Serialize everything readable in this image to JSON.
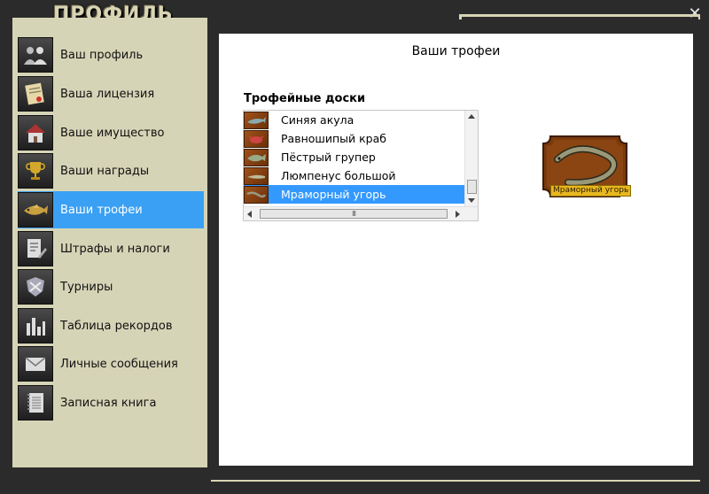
{
  "window": {
    "title": "ПРОФИЛЬ",
    "close_label": "✕"
  },
  "sidebar": {
    "items": [
      {
        "label": "Ваш профиль",
        "icon": "users-icon",
        "active": false
      },
      {
        "label": "Ваша лицензия",
        "icon": "license-icon",
        "active": false
      },
      {
        "label": "Ваше имущество",
        "icon": "house-icon",
        "active": false
      },
      {
        "label": "Ваши награды",
        "icon": "trophy-cup-icon",
        "active": false
      },
      {
        "label": "Ваши трофеи",
        "icon": "fish-trophy-icon",
        "active": true
      },
      {
        "label": "Штрафы и налоги",
        "icon": "fine-document-icon",
        "active": false
      },
      {
        "label": "Турниры",
        "icon": "tournament-emblem-icon",
        "active": false
      },
      {
        "label": "Таблица рекордов",
        "icon": "bar-chart-icon",
        "active": false
      },
      {
        "label": "Личные сообщения",
        "icon": "envelope-icon",
        "active": false
      },
      {
        "label": "Записная книга",
        "icon": "notebook-icon",
        "active": false
      }
    ]
  },
  "main": {
    "title": "Ваши трофеи",
    "boards_label": "Трофейные доски",
    "boards": [
      {
        "label": "Синяя акула",
        "selected": false
      },
      {
        "label": "Равношипый краб",
        "selected": false
      },
      {
        "label": "Пёстрый групер",
        "selected": false
      },
      {
        "label": "Люмпенус большой",
        "selected": false
      },
      {
        "label": "Мраморный угорь",
        "selected": true
      }
    ],
    "preview": {
      "label": "Мраморный угорь"
    },
    "hscroll_grip": "III"
  },
  "colors": {
    "accent": "#3aa0f4",
    "selection": "#3399ff",
    "sidebar_bg": "#d6d4b6",
    "frame_bg": "#2b2b2b",
    "plaque_wood": "#8b4513",
    "plaque_label": "#e8b820"
  }
}
